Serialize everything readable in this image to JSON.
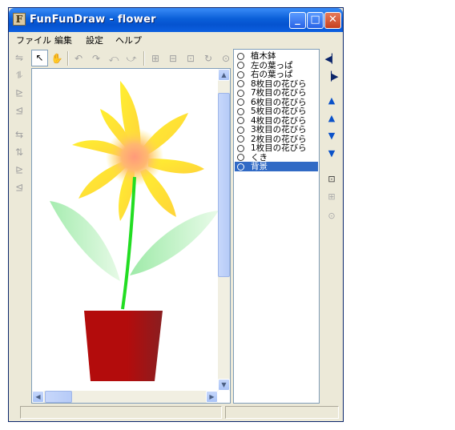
{
  "window": {
    "app_icon_letter": "F",
    "title": "FunFunDraw - flower",
    "buttons": {
      "minimize": "_",
      "maximize": "□",
      "close": "✕"
    }
  },
  "menu": [
    "ファイル",
    "編集",
    "設定",
    "ヘルプ"
  ],
  "left_tools": [
    "flip-horizontal-icon",
    "flip-vertical-icon",
    "align-bottom-icon",
    "align-left-icon",
    "swap-horizontal-icon",
    "swap-vertical-icon",
    "move-down-icon",
    "move-left-icon"
  ],
  "top_tools": [
    "select-arrow-icon",
    "hand-icon",
    "rotate-left-icon",
    "rotate-right-icon",
    "skew-left-icon",
    "skew-right-icon",
    "fit-icon",
    "fit-width-icon",
    "fit-height-icon",
    "refresh-icon",
    "zoom-icon"
  ],
  "layers": {
    "items": [
      "植木鉢",
      "左の葉っぱ",
      "右の葉っぱ",
      "8枚目の花びら",
      "7枚目の花びら",
      "6枚目の花びら",
      "5枚目の花びら",
      "4枚目の花びら",
      "3枚目の花びら",
      "2枚目の花びら",
      "1枚目の花びら",
      "くき",
      "背景"
    ],
    "selected_index": 12
  },
  "right_tools": [
    "previous-icon",
    "next-icon",
    "bring-to-front-icon",
    "bring-forward-icon",
    "send-backward-icon",
    "send-to-back-icon",
    "add-layer-icon",
    "duplicate-layer-icon",
    "properties-icon"
  ],
  "colors": {
    "pot": "#b01010",
    "stem": "#22dd22",
    "petal": "#ffe828",
    "center": "#ff9a7a",
    "leaf": "#a9f0a9",
    "selection": "#316ac5"
  }
}
